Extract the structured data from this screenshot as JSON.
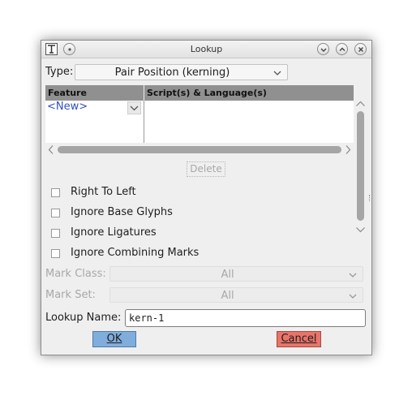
{
  "window": {
    "title": "Lookup"
  },
  "type_field": {
    "label": "Type:",
    "value": "Pair Position (kerning)"
  },
  "table": {
    "headers": [
      "Feature",
      "Script(s) & Language(s)"
    ],
    "new_entry": "<New>"
  },
  "delete_label": "Delete",
  "checkboxes": [
    {
      "label": "Right To Left",
      "checked": false
    },
    {
      "label": "Ignore Base Glyphs",
      "checked": false
    },
    {
      "label": "Ignore Ligatures",
      "checked": false
    },
    {
      "label": "Ignore Combining Marks",
      "checked": false
    }
  ],
  "mark_class": {
    "label": "Mark Class:",
    "value": "All"
  },
  "mark_set": {
    "label": "Mark Set:",
    "value": "All"
  },
  "lookup_name": {
    "label": "Lookup Name:",
    "value": "kern-1"
  },
  "buttons": {
    "ok": {
      "label": "OK",
      "color": "#7faedc"
    },
    "cancel": {
      "label": "Cancel",
      "color": "#e8746a"
    }
  }
}
